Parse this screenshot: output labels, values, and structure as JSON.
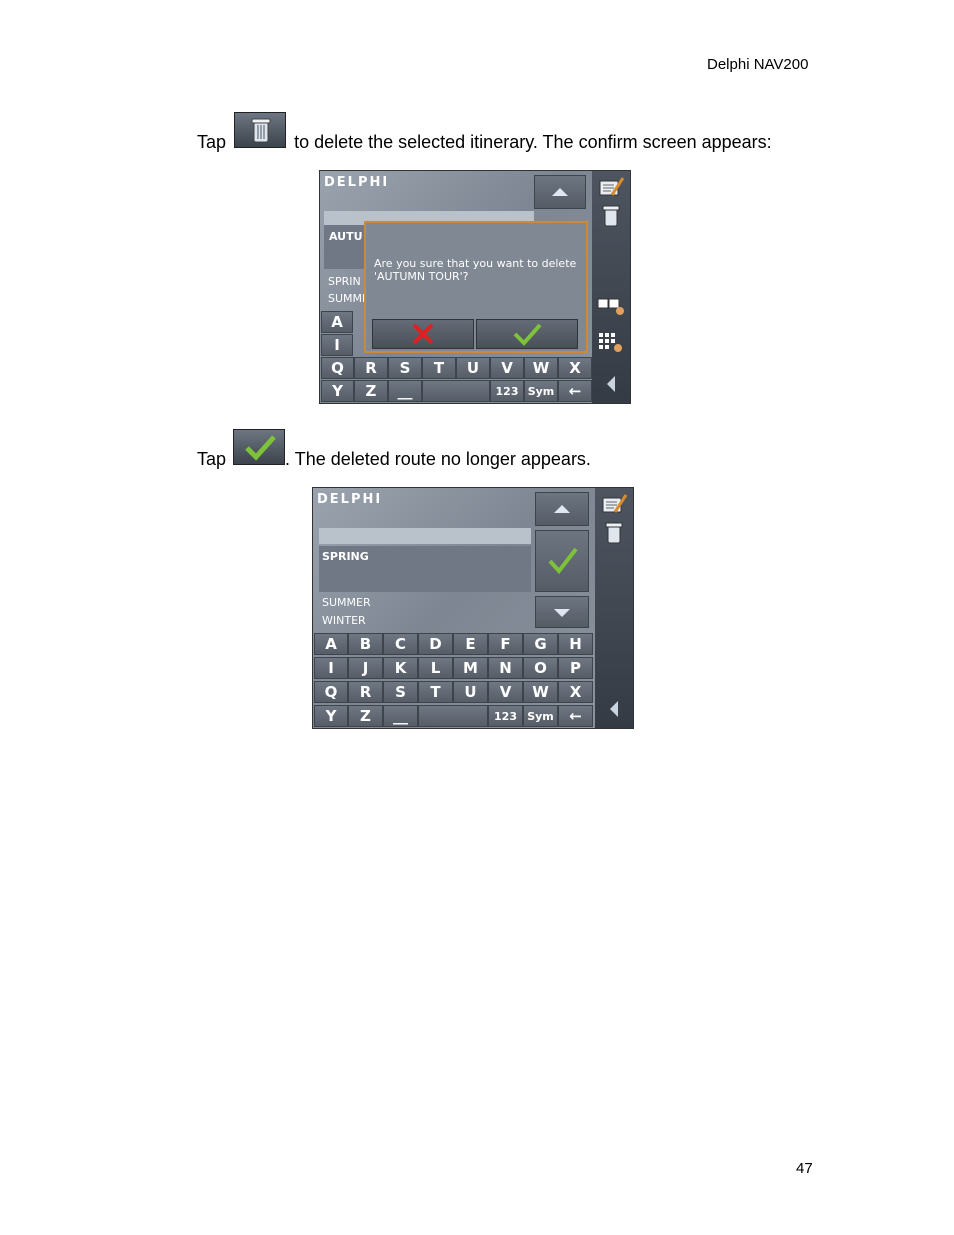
{
  "header": {
    "title": "Delphi NAV200"
  },
  "page_number": "47",
  "paragraph1": {
    "before": "Tap",
    "icon": "trash-icon",
    "after": "to delete the selected itinerary. The confirm screen appears:"
  },
  "paragraph2": {
    "before": "Tap",
    "icon": "checkmark-icon",
    "after": ". The deleted route no longer appears."
  },
  "screen1": {
    "logo": "DELPHI",
    "list_partial": [
      "AUTU",
      "SPRIN",
      "SUMME"
    ],
    "dialog_message": "Are you sure that you want to delete\n'AUTUMN TOUR'?",
    "keys_row1": [
      "A"
    ],
    "keys_row2": [
      "I"
    ],
    "keys_row3": [
      "Q",
      "R",
      "S",
      "T",
      "U",
      "V",
      "W",
      "X"
    ],
    "keys_row4": [
      "Y",
      "Z",
      "__",
      "",
      "123",
      "Sym",
      "←"
    ]
  },
  "screen2": {
    "logo": "DELPHI",
    "list_selected": "SPRING",
    "list_items": [
      "SUMMER",
      "WINTER"
    ],
    "keys_row1": [
      "A",
      "B",
      "C",
      "D",
      "E",
      "F",
      "G",
      "H"
    ],
    "keys_row2": [
      "I",
      "J",
      "K",
      "L",
      "M",
      "N",
      "O",
      "P"
    ],
    "keys_row3": [
      "Q",
      "R",
      "S",
      "T",
      "U",
      "V",
      "W",
      "X"
    ],
    "keys_row4": [
      "Y",
      "Z",
      "__",
      "",
      "123",
      "Sym",
      "←"
    ]
  },
  "colors": {
    "accent_border": "#c98a3a",
    "confirm_green": "#7ec23a",
    "cancel_red": "#e02020"
  }
}
